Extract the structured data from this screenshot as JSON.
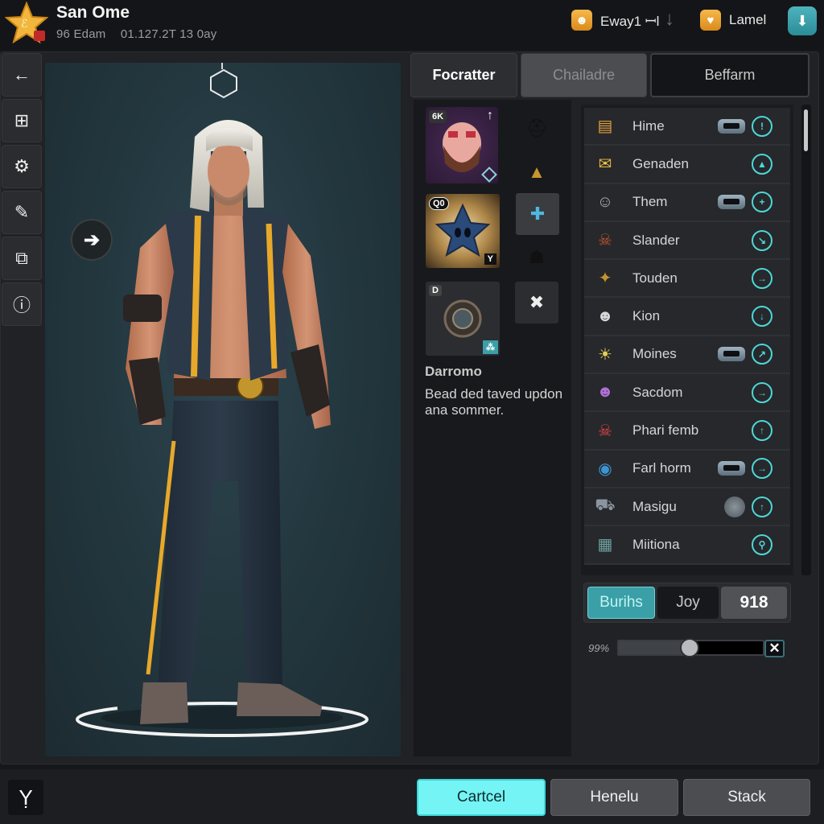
{
  "header": {
    "title": "San Ome",
    "subtitle": [
      "96 Edam",
      "01.127.2T 13 0ay"
    ],
    "currency_1": {
      "icon": "smile-coin-icon",
      "label": "Eway1 ꟷl"
    },
    "download_icon": "arrow-down-icon",
    "currency_2": {
      "icon": "heart-coin-icon",
      "label": "Lamel"
    },
    "app_icon": "teal-app-icon"
  },
  "sidebar": {
    "items": [
      {
        "name": "back",
        "icon": "arrow-left-icon",
        "glyph": "←"
      },
      {
        "name": "grid",
        "icon": "grid-icon",
        "glyph": "⊞"
      },
      {
        "name": "settings",
        "icon": "gear-icon",
        "glyph": "⚙"
      },
      {
        "name": "edit",
        "icon": "edit-circle-icon",
        "glyph": "✎"
      },
      {
        "name": "card",
        "icon": "id-card-icon",
        "glyph": "⧉"
      },
      {
        "name": "info",
        "icon": "info-icon",
        "glyph": "ⓘ"
      }
    ]
  },
  "viewport": {
    "next_glyph": "➔"
  },
  "tabs": [
    {
      "label": "Focratter",
      "state": "active"
    },
    {
      "label": "Chailadre",
      "state": "disabled"
    },
    {
      "label": "Beffarm",
      "state": "normal"
    }
  ],
  "inventory": {
    "slots": [
      {
        "name": "face-mask",
        "badge": "6K",
        "corner": "↑"
      },
      {
        "name": "dark-star",
        "badge": "Q0",
        "corner": "Y"
      },
      {
        "name": "coin-medallion",
        "badge": "D",
        "corner": "⁂"
      }
    ],
    "mini_slots": [
      {
        "name": "helmet",
        "glyph": "⛑"
      },
      {
        "name": "triangle-emblem",
        "glyph": "▲"
      },
      {
        "name": "blue-gem",
        "glyph": "✚"
      },
      {
        "name": "hood",
        "glyph": "☗"
      },
      {
        "name": "cross-blades",
        "glyph": "✖"
      }
    ],
    "selected_name": "Darromo",
    "selected_desc": "Bead ded taved updon ana sommer."
  },
  "list": {
    "items": [
      {
        "label": "Hime",
        "icon": "chest-icon",
        "glyph": "▤",
        "color": "#e2a13a",
        "badge": "pill",
        "action": "!"
      },
      {
        "label": "Genaden",
        "icon": "envelope-icon",
        "glyph": "✉",
        "color": "#f0c040",
        "badge": null,
        "action": "▲"
      },
      {
        "label": "Them",
        "icon": "monkey-icon",
        "glyph": "☺",
        "color": "#b0b0b0",
        "badge": "pill",
        "action": "+"
      },
      {
        "label": "Slander",
        "icon": "skull-icon",
        "glyph": "☠",
        "color": "#c0552a",
        "badge": null,
        "action": "↘"
      },
      {
        "label": "Touden",
        "icon": "golden-emblem-icon",
        "glyph": "✦",
        "color": "#c8932c",
        "badge": null,
        "action": "→"
      },
      {
        "label": "Kion",
        "icon": "mask-portrait-icon",
        "glyph": "☻",
        "color": "#d8d8d8",
        "badge": null,
        "action": "↓"
      },
      {
        "label": "Moines",
        "icon": "blonde-avatar-icon",
        "glyph": "☀",
        "color": "#e8cf55",
        "badge": "pill",
        "action": "↗"
      },
      {
        "label": "Sacdom",
        "icon": "purple-avatar-icon",
        "glyph": "☻",
        "color": "#b06fd6",
        "badge": null,
        "action": "→"
      },
      {
        "label": "Phari femb",
        "icon": "helmet-skull-icon",
        "glyph": "☠",
        "color": "#e04646",
        "badge": null,
        "action": "↑"
      },
      {
        "label": "Farl horm",
        "icon": "globe-avatar-icon",
        "glyph": "◉",
        "color": "#3d94d1",
        "badge": "pill",
        "action": "→"
      },
      {
        "label": "Masigu",
        "icon": "armored-truck-icon",
        "glyph": "⛟",
        "color": "#8a95a0",
        "badge": "round",
        "action": "↑"
      },
      {
        "label": "Miitiona",
        "icon": "map-icon",
        "glyph": "▦",
        "color": "#6fa0a0",
        "badge": null,
        "action": "⚲"
      }
    ]
  },
  "segmented": {
    "options": [
      "Burihs",
      "Joy",
      "918"
    ],
    "selected": "Burihs"
  },
  "slider": {
    "label": "99%",
    "value_fraction": 0.49,
    "close_glyph": "✕"
  },
  "footer": {
    "icon": "fork-icon",
    "icon_glyph": "Ỵ",
    "buttons": [
      "Cartcel",
      "Henelu",
      "Stack"
    ]
  },
  "colors": {
    "accent": "#74f4f4",
    "teal": "#3a9fa6",
    "gold": "#e8a82a",
    "background": "#16171a"
  }
}
